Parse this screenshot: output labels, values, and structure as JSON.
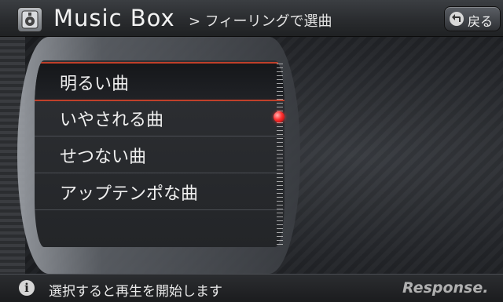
{
  "header": {
    "app_title": "Music Box",
    "breadcrumb": "> フィーリングで選曲",
    "back_label": "戻る"
  },
  "list": {
    "items": [
      {
        "label": "明るい曲",
        "selected": true
      },
      {
        "label": "いやされる曲",
        "selected": false
      },
      {
        "label": "せつない曲",
        "selected": false
      },
      {
        "label": "アップテンポな曲",
        "selected": false
      }
    ]
  },
  "footer": {
    "status_text": "選択すると再生を開始します",
    "watermark": "Response."
  },
  "icons": {
    "app": "music-box-icon",
    "back": "back-arrow-icon",
    "info": "info-icon"
  },
  "colors": {
    "accent": "#c0402a",
    "scroll_indicator": "#ff3030"
  }
}
